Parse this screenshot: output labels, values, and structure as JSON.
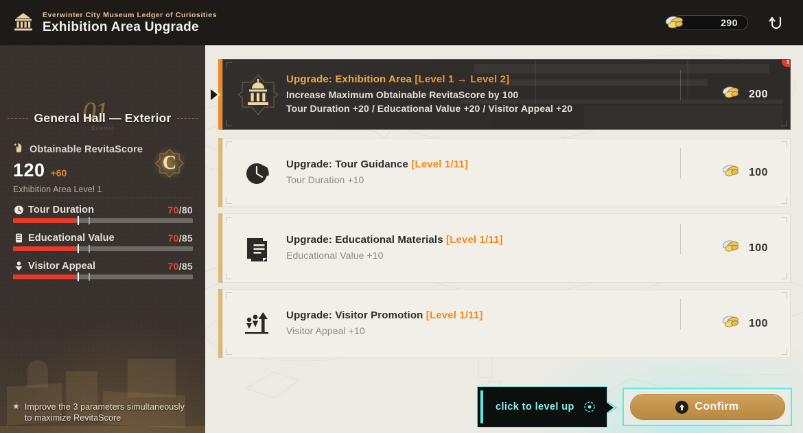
{
  "header": {
    "subtitle": "Everwinter City Museum Ledger of Curiosities",
    "title": "Exhibition Area Upgrade",
    "logo_icon": "museum-building-icon",
    "currency": {
      "amount": "290",
      "icon": "gold-coin-icon"
    },
    "back_icon": "back-arrow-icon"
  },
  "sidebar": {
    "deco_number": "01",
    "area_title": "General Hall — Exterior",
    "area_subtitle": "Exterior",
    "score": {
      "icon": "sparkle-hand-icon",
      "label": "Obtainable RevitaScore",
      "value": "120",
      "delta": "+60",
      "level_text": "Exhibition Area Level 1",
      "rank": "C"
    },
    "stats": [
      {
        "icon": "clock-icon",
        "name": "Tour Duration",
        "current": "70",
        "max": "/80",
        "fill_pct": 35,
        "tick_white_pct": 36,
        "tick_gray_pct": 42
      },
      {
        "icon": "book-icon",
        "name": "Educational Value",
        "current": "70",
        "max": "/85",
        "fill_pct": 35,
        "tick_white_pct": 36,
        "tick_gray_pct": 42
      },
      {
        "icon": "visitor-icon",
        "name": "Visitor Appeal",
        "current": "70",
        "max": "/85",
        "fill_pct": 35,
        "tick_white_pct": 36,
        "tick_gray_pct": 42
      }
    ],
    "footnote": {
      "bullet": "★",
      "text": "Improve the 3 parameters simultaneously to maximize RevitaScore"
    }
  },
  "cards": [
    {
      "selected": true,
      "icon": "museum-building-icon",
      "title": "Upgrade: Exhibition Area ",
      "level": "[Level 1 → Level 2]",
      "desc_line1": "Increase Maximum Obtainable RevitaScore by 100",
      "desc_line2": "Tour Duration +20 / Educational Value +20 / Visitor Appeal +20",
      "cost": "200",
      "cost_icon": "gold-coin-icon",
      "alert": "!"
    },
    {
      "selected": false,
      "icon": "clock-rotate-icon",
      "title": "Upgrade: Tour Guidance ",
      "level": "[Level 1/11]",
      "desc_line1": "Tour Duration +10",
      "desc_line2": "",
      "cost": "100",
      "cost_icon": "gold-coin-icon"
    },
    {
      "selected": false,
      "icon": "documents-icon",
      "title": "Upgrade: Educational Materials ",
      "level": "[Level 1/11]",
      "desc_line1": "Educational Value +10",
      "desc_line2": "",
      "cost": "100",
      "cost_icon": "gold-coin-icon"
    },
    {
      "selected": false,
      "icon": "people-up-arrow-icon",
      "title": "Upgrade: Visitor Promotion ",
      "level": "[Level 1/11]",
      "desc_line1": "Visitor Appeal +10",
      "desc_line2": "",
      "cost": "100",
      "cost_icon": "gold-coin-icon"
    }
  ],
  "actions": {
    "tooltip_text": "click to level up",
    "tooltip_cursor_icon": "cursor-click-icon",
    "confirm_label": "Confirm",
    "confirm_icon": "up-arrow-circle-icon"
  },
  "colors": {
    "accent_orange": "#ef8c1c",
    "accent_cyan": "#5fe7e3",
    "gold": "#c2924b",
    "stat_red": "#e8392a",
    "panel_cream": "#edeae3",
    "dark": "#2f2b28"
  }
}
